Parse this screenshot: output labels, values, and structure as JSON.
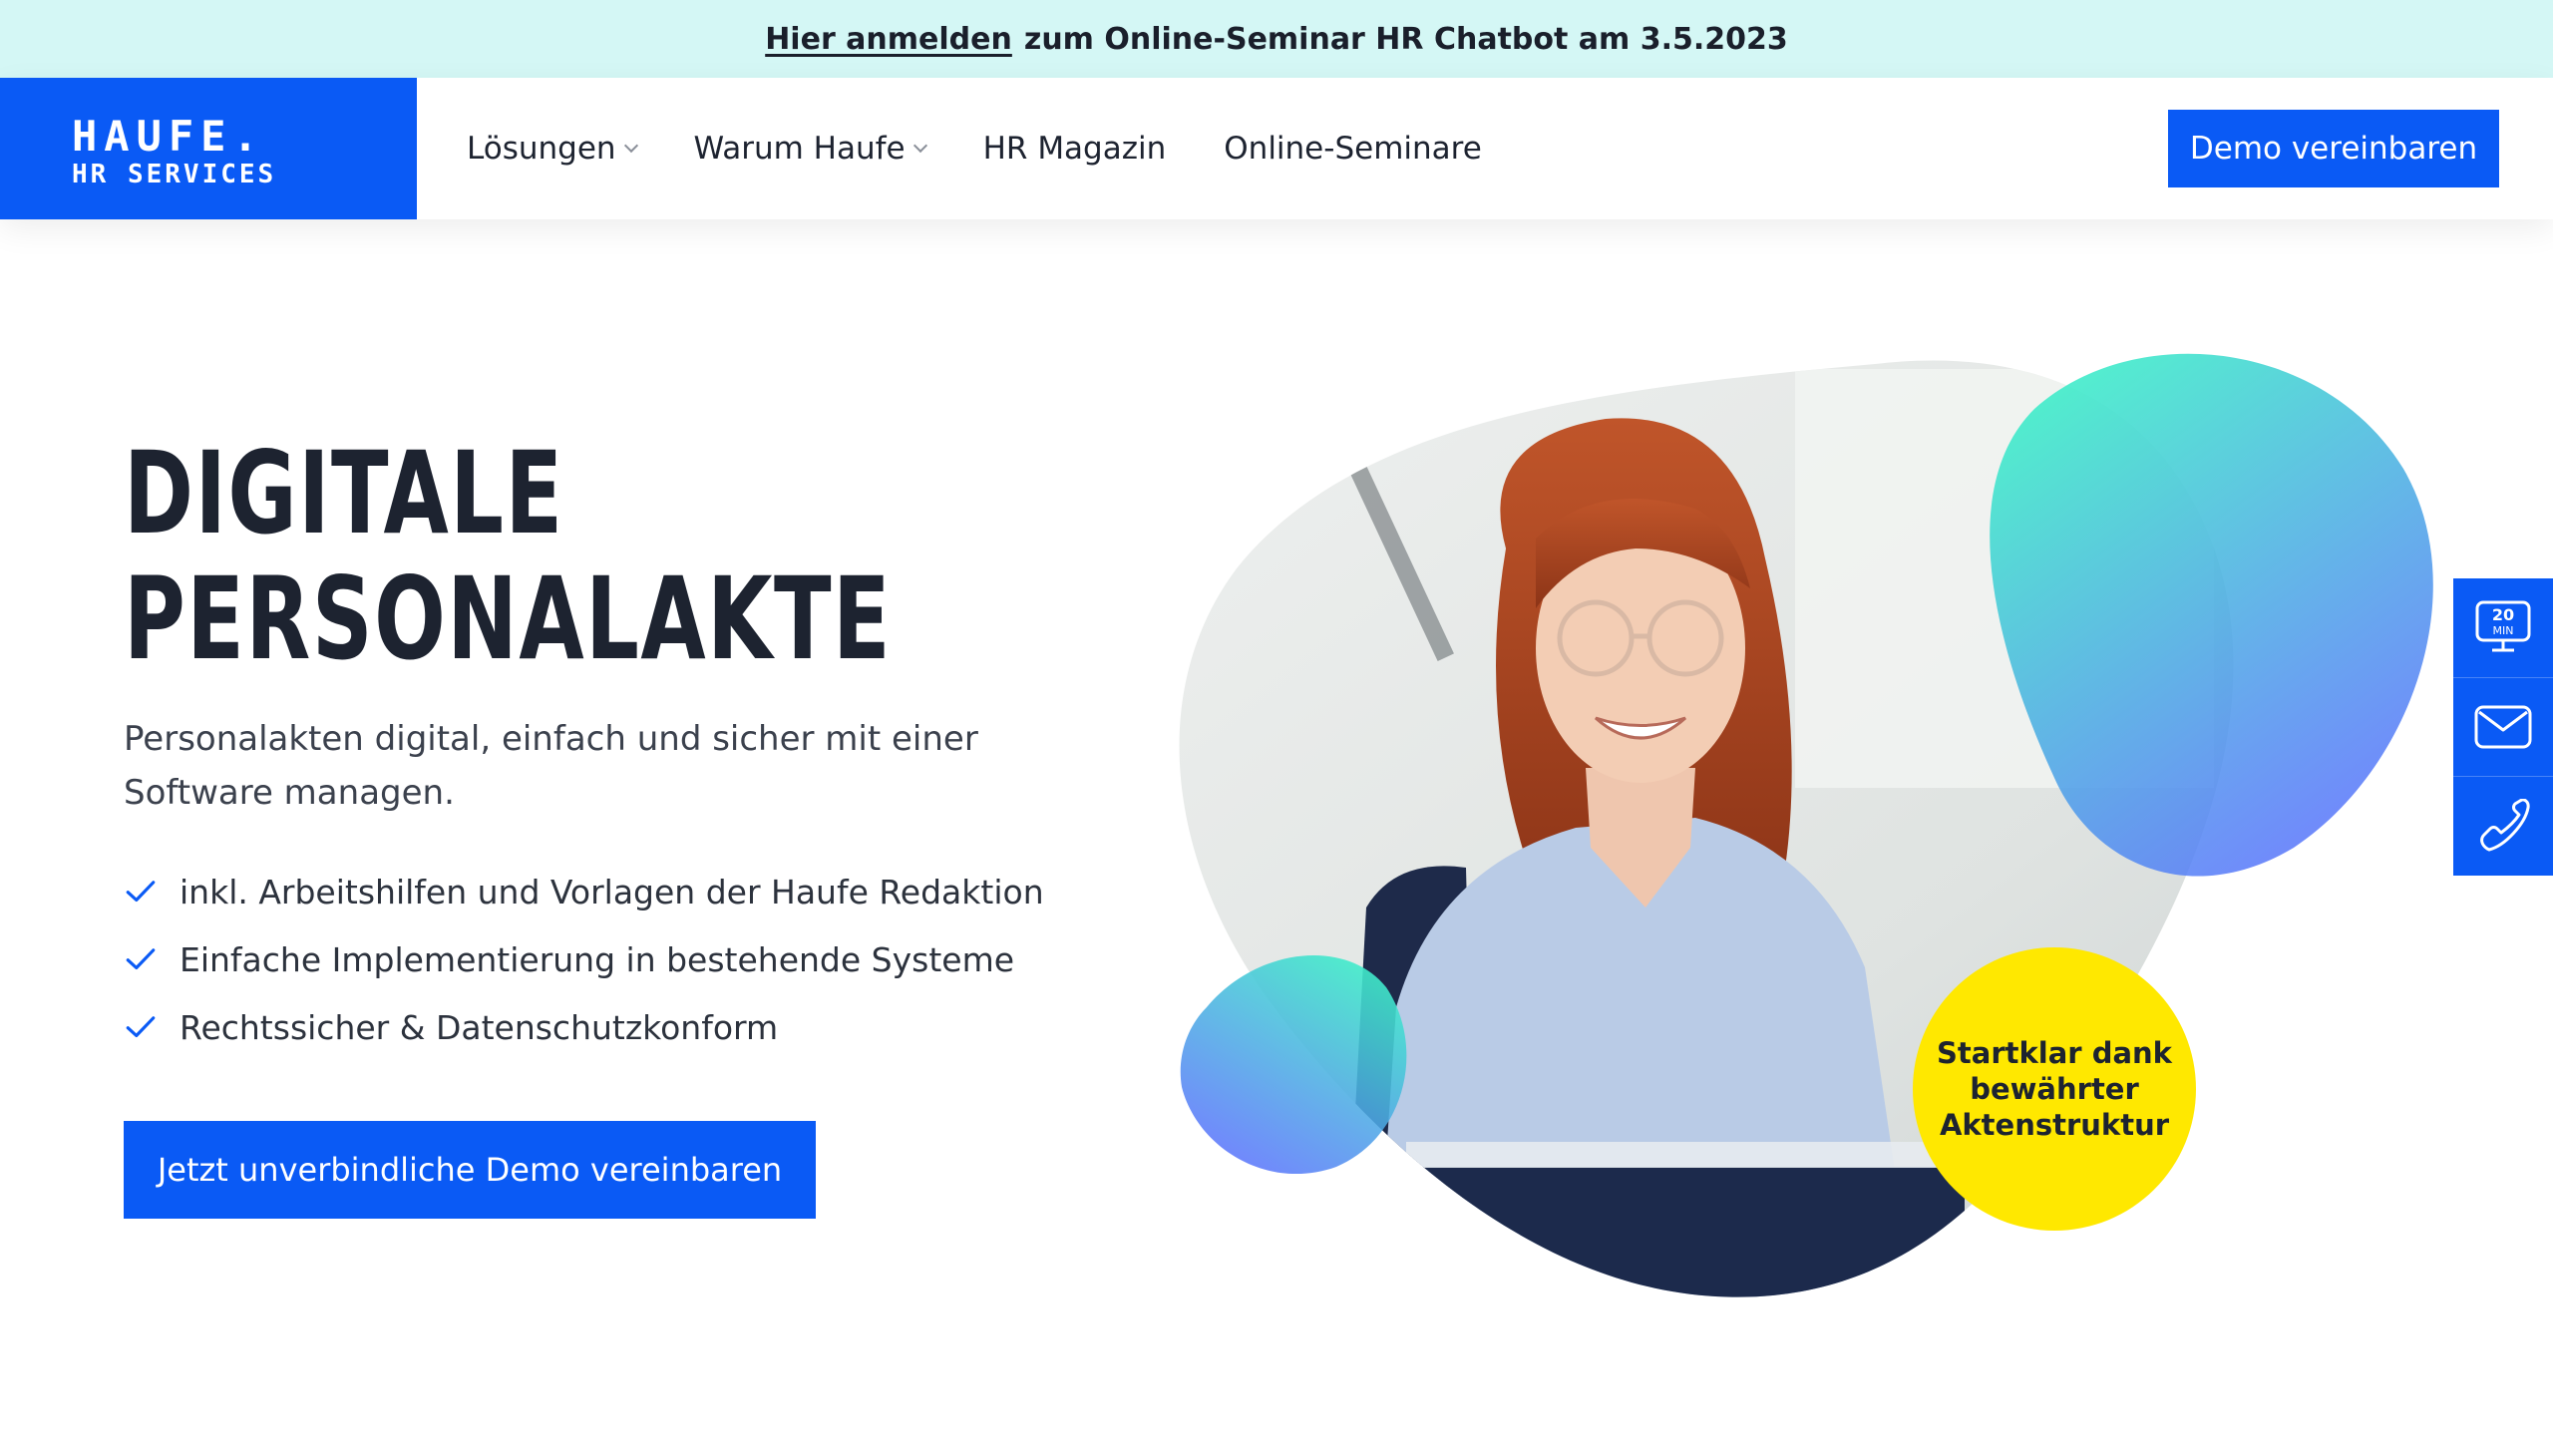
{
  "banner": {
    "link": "Hier anmelden",
    "text": "zum Online-Seminar HR Chatbot am 3.5.2023"
  },
  "logo": {
    "line1": "HAUFE.",
    "line2": "HR SERVICES"
  },
  "nav": {
    "items": [
      {
        "label": "Lösungen",
        "has_dropdown": true
      },
      {
        "label": "Warum Haufe",
        "has_dropdown": true
      },
      {
        "label": "HR Magazin",
        "has_dropdown": false
      },
      {
        "label": "Online-Seminare",
        "has_dropdown": false
      }
    ],
    "demo_button": "Demo vereinbaren"
  },
  "hero": {
    "title_line1": "DIGITALE",
    "title_line2": "PERSONALAKTE",
    "subtitle": "Personalakten digital, einfach und sicher mit einer Software managen.",
    "features": [
      "inkl. Arbeitshilfen und Vorlagen der Haufe Redaktion",
      "Einfache Implementierung in bestehende Systeme",
      "Rechtssicher & Datenschutzkonform"
    ],
    "cta": "Jetzt unverbindliche Demo vereinbaren",
    "badge": "Startklar dank bewährter Aktenstruktur"
  },
  "rail": {
    "icons": [
      "monitor-20-min-icon",
      "mail-icon",
      "phone-icon"
    ],
    "monitor_line1": "20",
    "monitor_line2": "MIN"
  },
  "colors": {
    "brand_blue": "#0a5af5",
    "banner_bg": "#d4f7f5",
    "badge_yellow": "#ffe800",
    "text_dark": "#1d2330"
  }
}
